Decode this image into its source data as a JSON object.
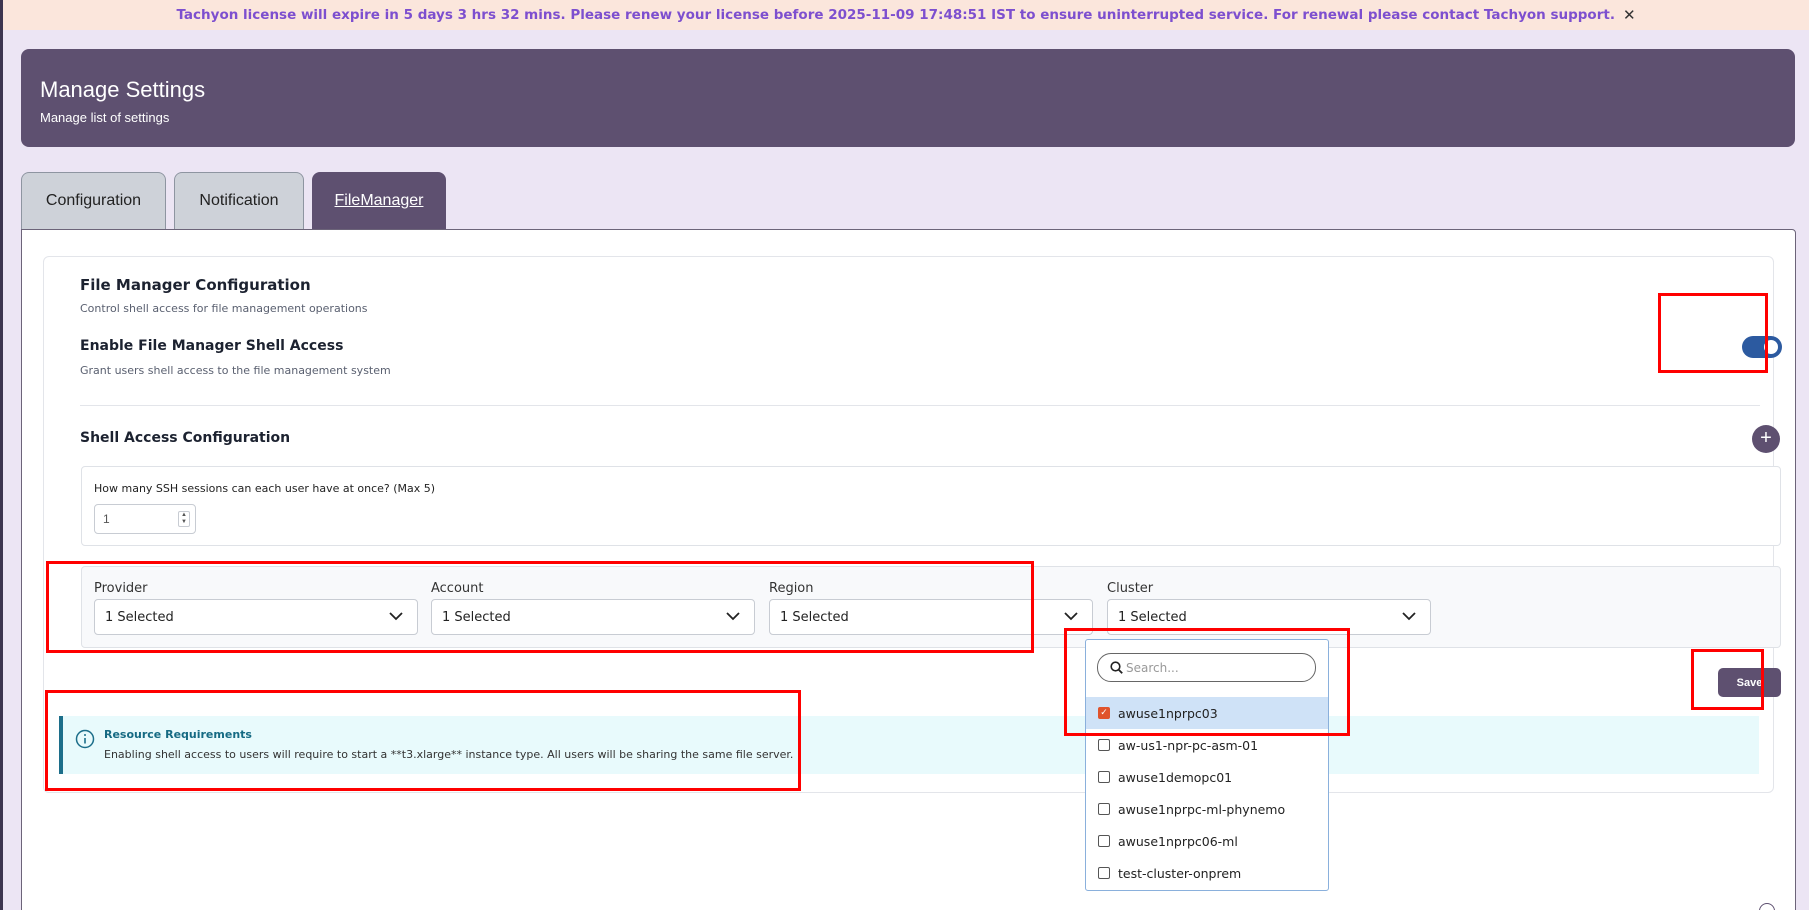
{
  "banner": {
    "message": "Tachyon license will expire in 5 days 3 hrs 32 mins. Please renew your license before 2025-11-09 17:48:51 IST to ensure uninterrupted service. For renewal please contact Tachyon support.",
    "close": "✕"
  },
  "header": {
    "title": "Manage Settings",
    "subtitle": "Manage list of settings"
  },
  "tabs": [
    {
      "label": "Configuration"
    },
    {
      "label": "Notification"
    },
    {
      "label": "FileManager"
    }
  ],
  "file_manager": {
    "title": "File Manager Configuration",
    "subtitle": "Control shell access for file management operations",
    "shell_title": "Enable File Manager Shell Access",
    "shell_desc": "Grant users shell access to the file management system",
    "shell_enabled": true
  },
  "shell_config": {
    "title": "Shell Access Configuration",
    "add": "+",
    "ssh_label": "How many SSH sessions can each user have at once? (Max 5)",
    "ssh_value": "1"
  },
  "filters": {
    "provider_label": "Provider",
    "provider_value": "1 Selected",
    "account_label": "Account",
    "account_value": "1 Selected",
    "region_label": "Region",
    "region_value": "1 Selected",
    "cluster_label": "Cluster",
    "cluster_value": "1 Selected"
  },
  "save_label": "Save",
  "info": {
    "title": "Resource Requirements",
    "text": "Enabling shell access to users will require to start a **t3.xlarge** instance type. All users will be sharing the same file server."
  },
  "dropdown": {
    "search_placeholder": "Search...",
    "options": [
      {
        "label": "awuse1nprpc03",
        "checked": true
      },
      {
        "label": "aw-us1-npr-pc-asm-01",
        "checked": false
      },
      {
        "label": "awuse1demopc01",
        "checked": false
      },
      {
        "label": "awuse1nprpc-ml-phynemo",
        "checked": false
      },
      {
        "label": "awuse1nprpc06-ml",
        "checked": false
      },
      {
        "label": "test-cluster-onprem",
        "checked": false
      }
    ]
  },
  "colors": {
    "primary": "#5e5070",
    "toggle": "#2c5aa0",
    "checkbox": "#e0532c",
    "banner_text": "#7d4fcf",
    "highlight": "#ff0000"
  }
}
